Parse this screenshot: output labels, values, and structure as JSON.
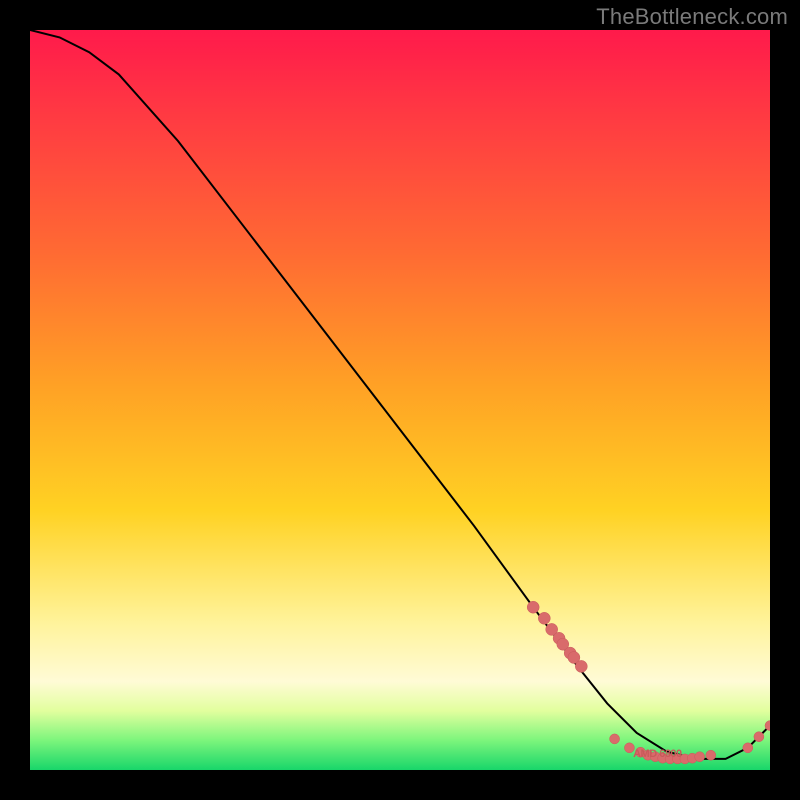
{
  "watermark": "TheBottleneck.com",
  "chart_data": {
    "type": "line",
    "title": "",
    "xlabel": "",
    "ylabel": "",
    "xlim": [
      0,
      100
    ],
    "ylim": [
      0,
      100
    ],
    "curve": {
      "x": [
        0,
        4,
        8,
        12,
        20,
        30,
        40,
        50,
        60,
        68,
        74,
        78,
        82,
        86,
        90,
        94,
        97,
        100
      ],
      "y": [
        100,
        99,
        97,
        94,
        85,
        72,
        59,
        46,
        33,
        22,
        14,
        9,
        5,
        2.5,
        1.5,
        1.5,
        3,
        6
      ]
    },
    "points_left_cluster": {
      "x": [
        68,
        69.5,
        70.5,
        71.5,
        72,
        73,
        73.5,
        74.5
      ],
      "y": [
        22,
        20.5,
        19,
        17.8,
        17,
        15.8,
        15.2,
        14
      ]
    },
    "points_bottom_cluster": {
      "x": [
        79,
        81,
        82.5,
        83.5,
        84.5,
        85.5,
        86.5,
        87.5,
        88.5,
        89.5,
        90.5,
        92
      ],
      "y": [
        4.2,
        3.0,
        2.4,
        2.0,
        1.8,
        1.6,
        1.5,
        1.5,
        1.5,
        1.6,
        1.8,
        2.0
      ]
    },
    "points_right_tail": {
      "x": [
        97,
        98.5,
        100
      ],
      "y": [
        3.0,
        4.5,
        6.0
      ]
    },
    "bottom_text_label": "AMD 6800"
  },
  "colors": {
    "dot": "#d96b6b",
    "curve": "#000000",
    "bg_top": "#ff1a4b",
    "bg_bottom": "#18d66a"
  }
}
